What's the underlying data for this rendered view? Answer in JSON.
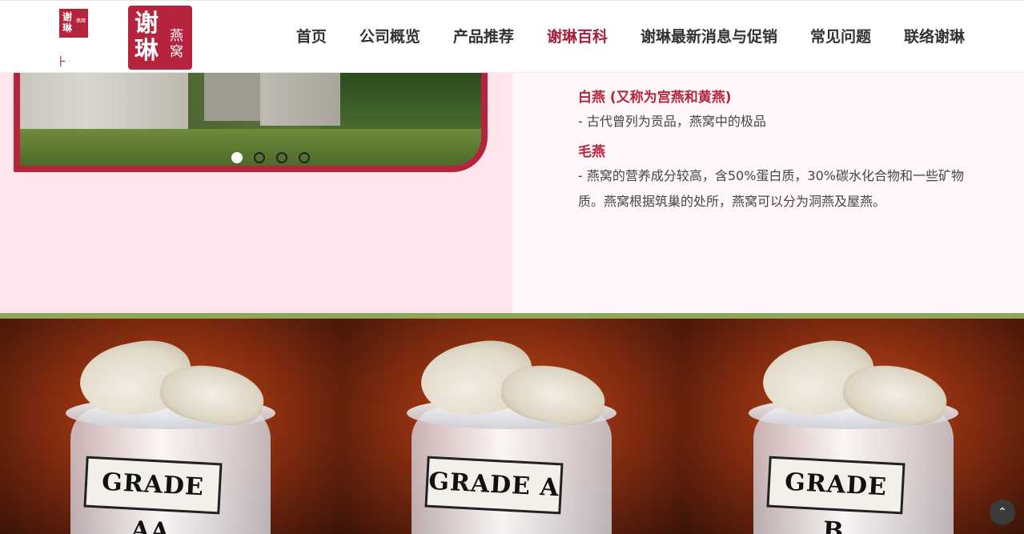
{
  "header": {
    "logo_small": {
      "line1": "谢",
      "line2": "琳",
      "sub": "燕窝"
    },
    "logo_main": {
      "big": "谢琳",
      "small": "燕窝"
    },
    "nav": [
      {
        "label": "首页",
        "active": false
      },
      {
        "label": "公司概览",
        "active": false
      },
      {
        "label": "产品推荐",
        "active": false
      },
      {
        "label": "谢琳百科",
        "active": true
      },
      {
        "label": "谢琳最新消息与促销",
        "active": false
      },
      {
        "label": "常见问题",
        "active": false
      },
      {
        "label": "联络谢琳",
        "active": false
      }
    ]
  },
  "slider": {
    "total": 4,
    "active_index": 0
  },
  "content": {
    "grade1_title": "白燕 (又称为宫燕和黄燕)",
    "grade1_desc": "- 古代曾列为贡品，燕窝中的极品",
    "grade2_title": "毛燕",
    "grade2_desc": "- 燕窝的营养成分较高，含50%蛋白质，30%碳水化合物和一些矿物质。燕窝根据筑巢的处所，燕窝可以分为洞燕及屋燕。"
  },
  "photos": [
    {
      "label": "GRADE AA"
    },
    {
      "label": "GRADE A"
    },
    {
      "label": "GRADE B"
    }
  ],
  "back_to_top": "⌃",
  "colors": {
    "brand": "#b5243c",
    "divider": "#8ea75a",
    "left_bg": "#ffe4ec"
  }
}
